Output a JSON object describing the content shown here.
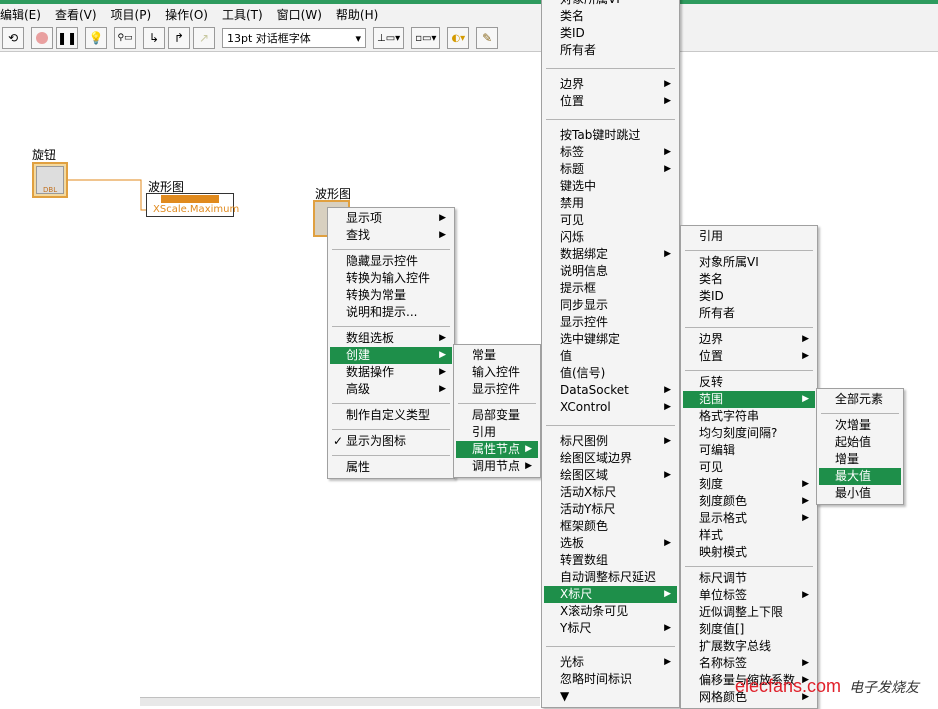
{
  "menubar": [
    "编辑(E)",
    "查看(V)",
    "项目(P)",
    "操作(O)",
    "工具(T)",
    "窗口(W)",
    "帮助(H)"
  ],
  "toolbar": {
    "font": "13pt 对话框字体",
    "icons": [
      "run-continuous-icon",
      "abort-icon",
      "pause-icon",
      "highlight-icon",
      "retain-wire-icon",
      "step-into-icon",
      "step-over-icon",
      "step-out-icon",
      "align-icon",
      "distribute-icon",
      "reorder-icon",
      "cleanup-icon"
    ]
  },
  "diagram": {
    "knob_label": "旋钮",
    "knob_badge": "DBL",
    "prop_label": "波形图",
    "prop_value": "XScale.Maximum",
    "graph_label": "波形图"
  },
  "colors": {
    "highlight": "#1e8f4a",
    "wire": "#e08a1e"
  },
  "menus": [
    {
      "id": "m1",
      "items": [
        {
          "label": "显示项",
          "arrow": true
        },
        {
          "label": "查找",
          "arrow": true
        },
        {
          "sep": true
        },
        {
          "label": "隐藏显示控件"
        },
        {
          "label": "转换为输入控件"
        },
        {
          "label": "转换为常量"
        },
        {
          "label": "说明和提示..."
        },
        {
          "sep": true
        },
        {
          "label": "数组选板",
          "arrow": true
        },
        {
          "label": "创建",
          "arrow": true,
          "hl": true
        },
        {
          "label": "数据操作",
          "arrow": true
        },
        {
          "label": "高级",
          "arrow": true
        },
        {
          "sep": true
        },
        {
          "label": "制作自定义类型"
        },
        {
          "sep": true
        },
        {
          "label": "显示为图标",
          "check": true
        },
        {
          "sep": true
        },
        {
          "label": "属性"
        }
      ]
    },
    {
      "id": "m2",
      "items": [
        {
          "label": "常量"
        },
        {
          "label": "输入控件"
        },
        {
          "label": "显示控件"
        },
        {
          "sep": true
        },
        {
          "label": "局部变量"
        },
        {
          "label": "引用"
        },
        {
          "label": "属性节点",
          "arrow": true,
          "hl": true
        },
        {
          "label": "调用节点",
          "arrow": true
        }
      ]
    },
    {
      "id": "m4",
      "items": [
        {
          "label": "对象所属VI"
        },
        {
          "label": "类名"
        },
        {
          "label": "类ID"
        },
        {
          "label": "所有者"
        },
        {
          "sep": true
        },
        {
          "label": "边界",
          "arrow": true
        },
        {
          "label": "位置",
          "arrow": true
        },
        {
          "sep": true
        },
        {
          "label": "按Tab键时跳过"
        },
        {
          "label": "标签",
          "arrow": true
        },
        {
          "label": "标题",
          "arrow": true
        },
        {
          "label": "键选中"
        },
        {
          "label": "禁用"
        },
        {
          "label": "可见"
        },
        {
          "label": "闪烁"
        },
        {
          "label": "数据绑定",
          "arrow": true
        },
        {
          "label": "说明信息"
        },
        {
          "label": "提示框"
        },
        {
          "label": "同步显示"
        },
        {
          "label": "显示控件"
        },
        {
          "label": "选中键绑定"
        },
        {
          "label": "值"
        },
        {
          "label": "值(信号)"
        },
        {
          "label": "DataSocket",
          "arrow": true
        },
        {
          "label": "XControl",
          "arrow": true
        },
        {
          "sep": true
        },
        {
          "label": "标尺图例",
          "arrow": true
        },
        {
          "label": "绘图区域边界"
        },
        {
          "label": "绘图区域",
          "arrow": true
        },
        {
          "label": "活动X标尺"
        },
        {
          "label": "活动Y标尺"
        },
        {
          "label": "框架颜色"
        },
        {
          "label": "选板",
          "arrow": true
        },
        {
          "label": "转置数组"
        },
        {
          "label": "自动调整标尺延迟"
        },
        {
          "label": "X标尺",
          "arrow": true,
          "hl": true
        },
        {
          "label": "X滚动条可见"
        },
        {
          "label": "Y标尺",
          "arrow": true
        },
        {
          "sep": true
        },
        {
          "label": "光标",
          "arrow": true
        },
        {
          "label": "忽略时间标识"
        },
        {
          "label": "▼"
        }
      ]
    },
    {
      "id": "m5",
      "items": [
        {
          "label": "引用"
        },
        {
          "sep": true
        },
        {
          "label": "对象所属VI"
        },
        {
          "label": "类名"
        },
        {
          "label": "类ID"
        },
        {
          "label": "所有者"
        },
        {
          "sep": true
        },
        {
          "label": "边界",
          "arrow": true
        },
        {
          "label": "位置",
          "arrow": true
        },
        {
          "sep": true
        },
        {
          "label": "反转"
        },
        {
          "label": "范围",
          "arrow": true,
          "hl": true
        },
        {
          "label": "格式字符串"
        },
        {
          "label": "均匀刻度间隔?"
        },
        {
          "label": "可编辑"
        },
        {
          "label": "可见"
        },
        {
          "label": "刻度",
          "arrow": true
        },
        {
          "label": "刻度颜色",
          "arrow": true
        },
        {
          "label": "显示格式",
          "arrow": true
        },
        {
          "label": "样式"
        },
        {
          "label": "映射模式"
        },
        {
          "sep": true
        },
        {
          "label": "标尺调节"
        },
        {
          "label": "单位标签",
          "arrow": true
        },
        {
          "label": "近似调整上下限"
        },
        {
          "label": "刻度值[]"
        },
        {
          "label": "扩展数字总线"
        },
        {
          "label": "名称标签",
          "arrow": true
        },
        {
          "label": "偏移量与缩放系数",
          "arrow": true
        },
        {
          "label": "网格颜色",
          "arrow": true
        }
      ]
    },
    {
      "id": "m6",
      "items": [
        {
          "label": "全部元素"
        },
        {
          "sep": true
        },
        {
          "label": "次增量"
        },
        {
          "label": "起始值"
        },
        {
          "label": "增量"
        },
        {
          "label": "最大值",
          "hl": true
        },
        {
          "label": "最小值"
        }
      ]
    }
  ],
  "watermark": {
    "text": "elecfans.com",
    "cn": "电子发烧友"
  }
}
